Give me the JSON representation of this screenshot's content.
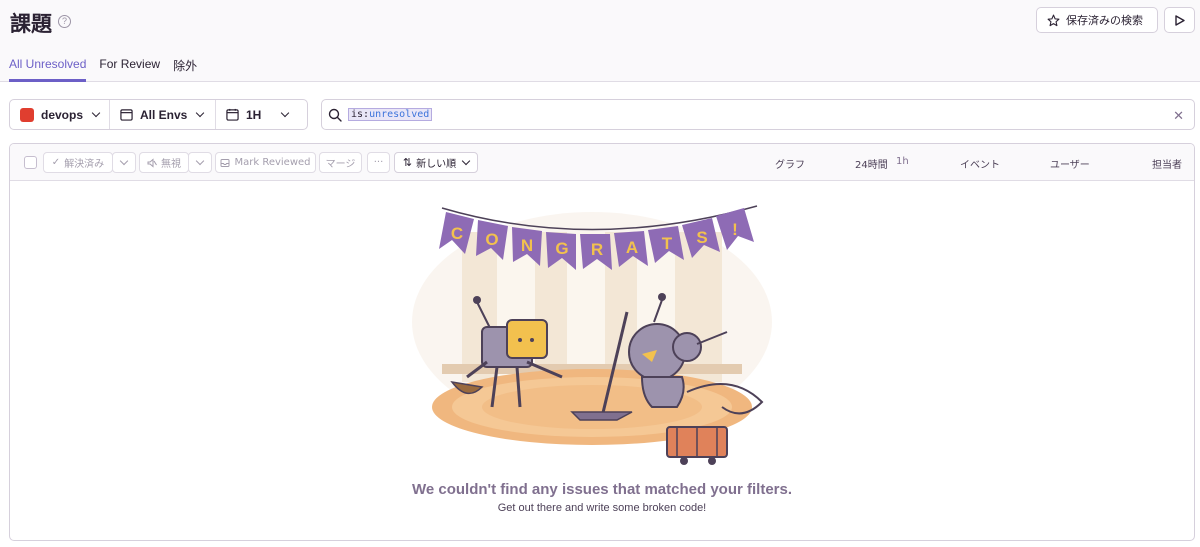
{
  "header": {
    "title": "課題",
    "saved_search_label": "保存済みの検索",
    "tabs": [
      "All Unresolved",
      "For Review",
      "除外"
    ]
  },
  "filters": {
    "project": "devops",
    "environment": "All Envs",
    "period": "1H"
  },
  "search": {
    "token_key": "is:",
    "token_value": "unresolved"
  },
  "actions": {
    "resolve": "解決済み",
    "ignore": "無視",
    "mark_reviewed": "Mark Reviewed",
    "merge": "マージ",
    "more": "···",
    "sort": "新しい順"
  },
  "columns": {
    "graph": "グラフ",
    "period_24h": "24時間",
    "period_1h": "1h",
    "events": "イベント",
    "users": "ユーザー",
    "assignee": "担当者"
  },
  "empty_state": {
    "banner_letters": [
      "C",
      "O",
      "N",
      "G",
      "R",
      "A",
      "T",
      "S",
      "!"
    ],
    "title": "We couldn't find any issues that matched your filters.",
    "subtitle": "Get out there and write some broken code!"
  },
  "colors": {
    "accent": "#6c5fc7",
    "project_badge": "#e03e2f",
    "pennant": "#8e6bb5",
    "pennant_letter": "#f2c14e"
  }
}
